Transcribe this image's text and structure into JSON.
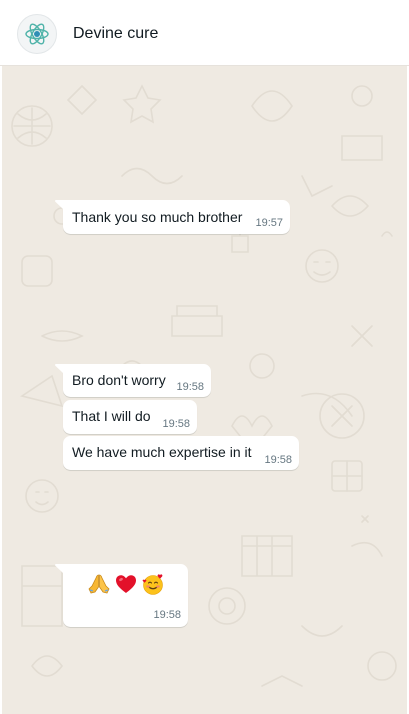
{
  "header": {
    "contact_name": "Devine cure",
    "avatar_icon": "atom-logo-icon"
  },
  "colors": {
    "chat_background": "#efeae2",
    "bubble": "#ffffff",
    "timestamp": "#667781",
    "avatar_accent": "#4fb3a9"
  },
  "messages": [
    {
      "text": "Thank you so much brother",
      "time": "19:57"
    },
    {
      "text": "Bro don't worry",
      "time": "19:58"
    },
    {
      "text": "That I will do",
      "time": "19:58"
    },
    {
      "text": "We have much expertise in it",
      "time": "19:58"
    },
    {
      "emojis": [
        "folded-hands-icon",
        "red-heart-icon",
        "smiling-face-with-hearts-icon"
      ],
      "time": "19:58"
    }
  ]
}
